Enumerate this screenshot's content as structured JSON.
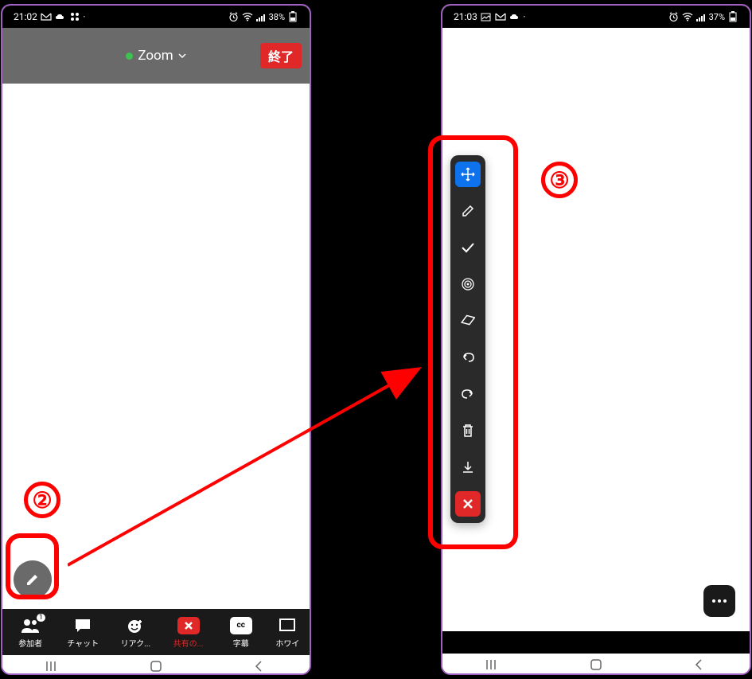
{
  "phone1": {
    "status": {
      "time": "21:02",
      "battery": "38%"
    },
    "header": {
      "title": "Zoom",
      "end": "終了"
    },
    "toolbar": {
      "participants": {
        "label": "参加者",
        "badge": "1"
      },
      "chat": {
        "label": "チャット"
      },
      "reactions": {
        "label": "リアク..."
      },
      "share": {
        "label": "共有の..."
      },
      "captions": {
        "label": "字幕",
        "cc": "cc"
      },
      "whiteboard": {
        "label": "ホワイ"
      }
    }
  },
  "phone2": {
    "status": {
      "time": "21:03",
      "battery": "37%"
    }
  },
  "annotations": {
    "step2": "②",
    "step3": "③"
  }
}
